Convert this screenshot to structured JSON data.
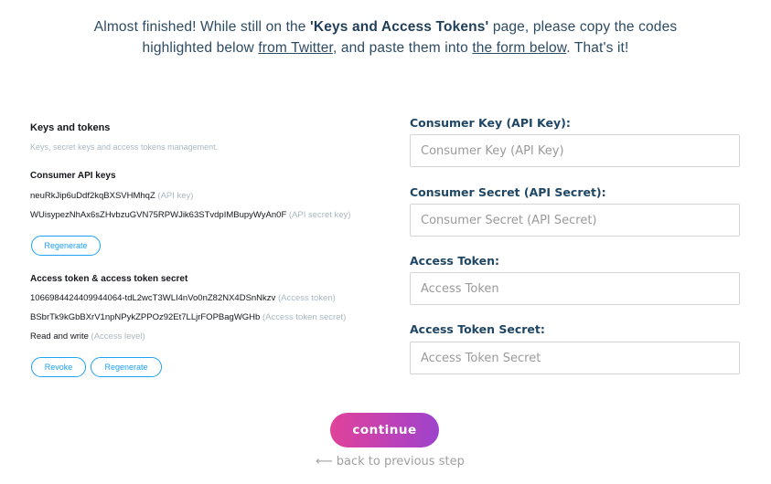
{
  "intro": {
    "part1": "Almost finished! While still on the ",
    "highlight": "'Keys and Access Tokens'",
    "part2": " page, please copy the codes highlighted below ",
    "link_twitter": "from Twitter",
    "part3": ", and paste them into ",
    "link_form": "the form below",
    "part4": ". That's it!"
  },
  "twitter_panel": {
    "title": "Keys and tokens",
    "subtitle": "Keys, secret keys and access tokens management.",
    "consumer_heading": "Consumer API keys",
    "api_key": "neuRkJip6uDdf2kqBXSVHMhqZ",
    "api_key_note": "(API key)",
    "api_secret": "WUisypezNhAx6sZHvbzuGVN75RPWJik63STvdpIMBupyWyAn0F",
    "api_secret_note": "(API secret key)",
    "regenerate_label": "Regenerate",
    "access_heading": "Access token & access token secret",
    "access_token": "1066984424409944064-tdL2wcT3WLI4nVo0nZ82NX4DSnNkzv",
    "access_token_note": "(Access token)",
    "access_secret": "BSbrTk9kGbBXrV1npNPykZPPOz92Et7LLjrFOPBagWGHb",
    "access_secret_note": "(Access token secret)",
    "access_level": "Read and write",
    "access_level_note": "(Access level)",
    "revoke_label": "Revoke",
    "regenerate2_label": "Regenerate"
  },
  "form": {
    "consumer_key_label": "Consumer Key (API Key):",
    "consumer_key_placeholder": "Consumer Key (API Key)",
    "consumer_secret_label": "Consumer Secret (API Secret):",
    "consumer_secret_placeholder": "Consumer Secret (API Secret)",
    "access_token_label": "Access Token:",
    "access_token_placeholder": "Access Token",
    "access_secret_label": "Access Token Secret:",
    "access_secret_placeholder": "Access Token Secret"
  },
  "actions": {
    "continue_label": "continue",
    "back_arrow": "⟵",
    "back_label": "back to previous step"
  },
  "colors": {
    "twitter_blue": "#1da1f2",
    "heading_navy": "#1f4664",
    "gradient_start": "#e0429a",
    "gradient_end": "#9d43cc"
  }
}
